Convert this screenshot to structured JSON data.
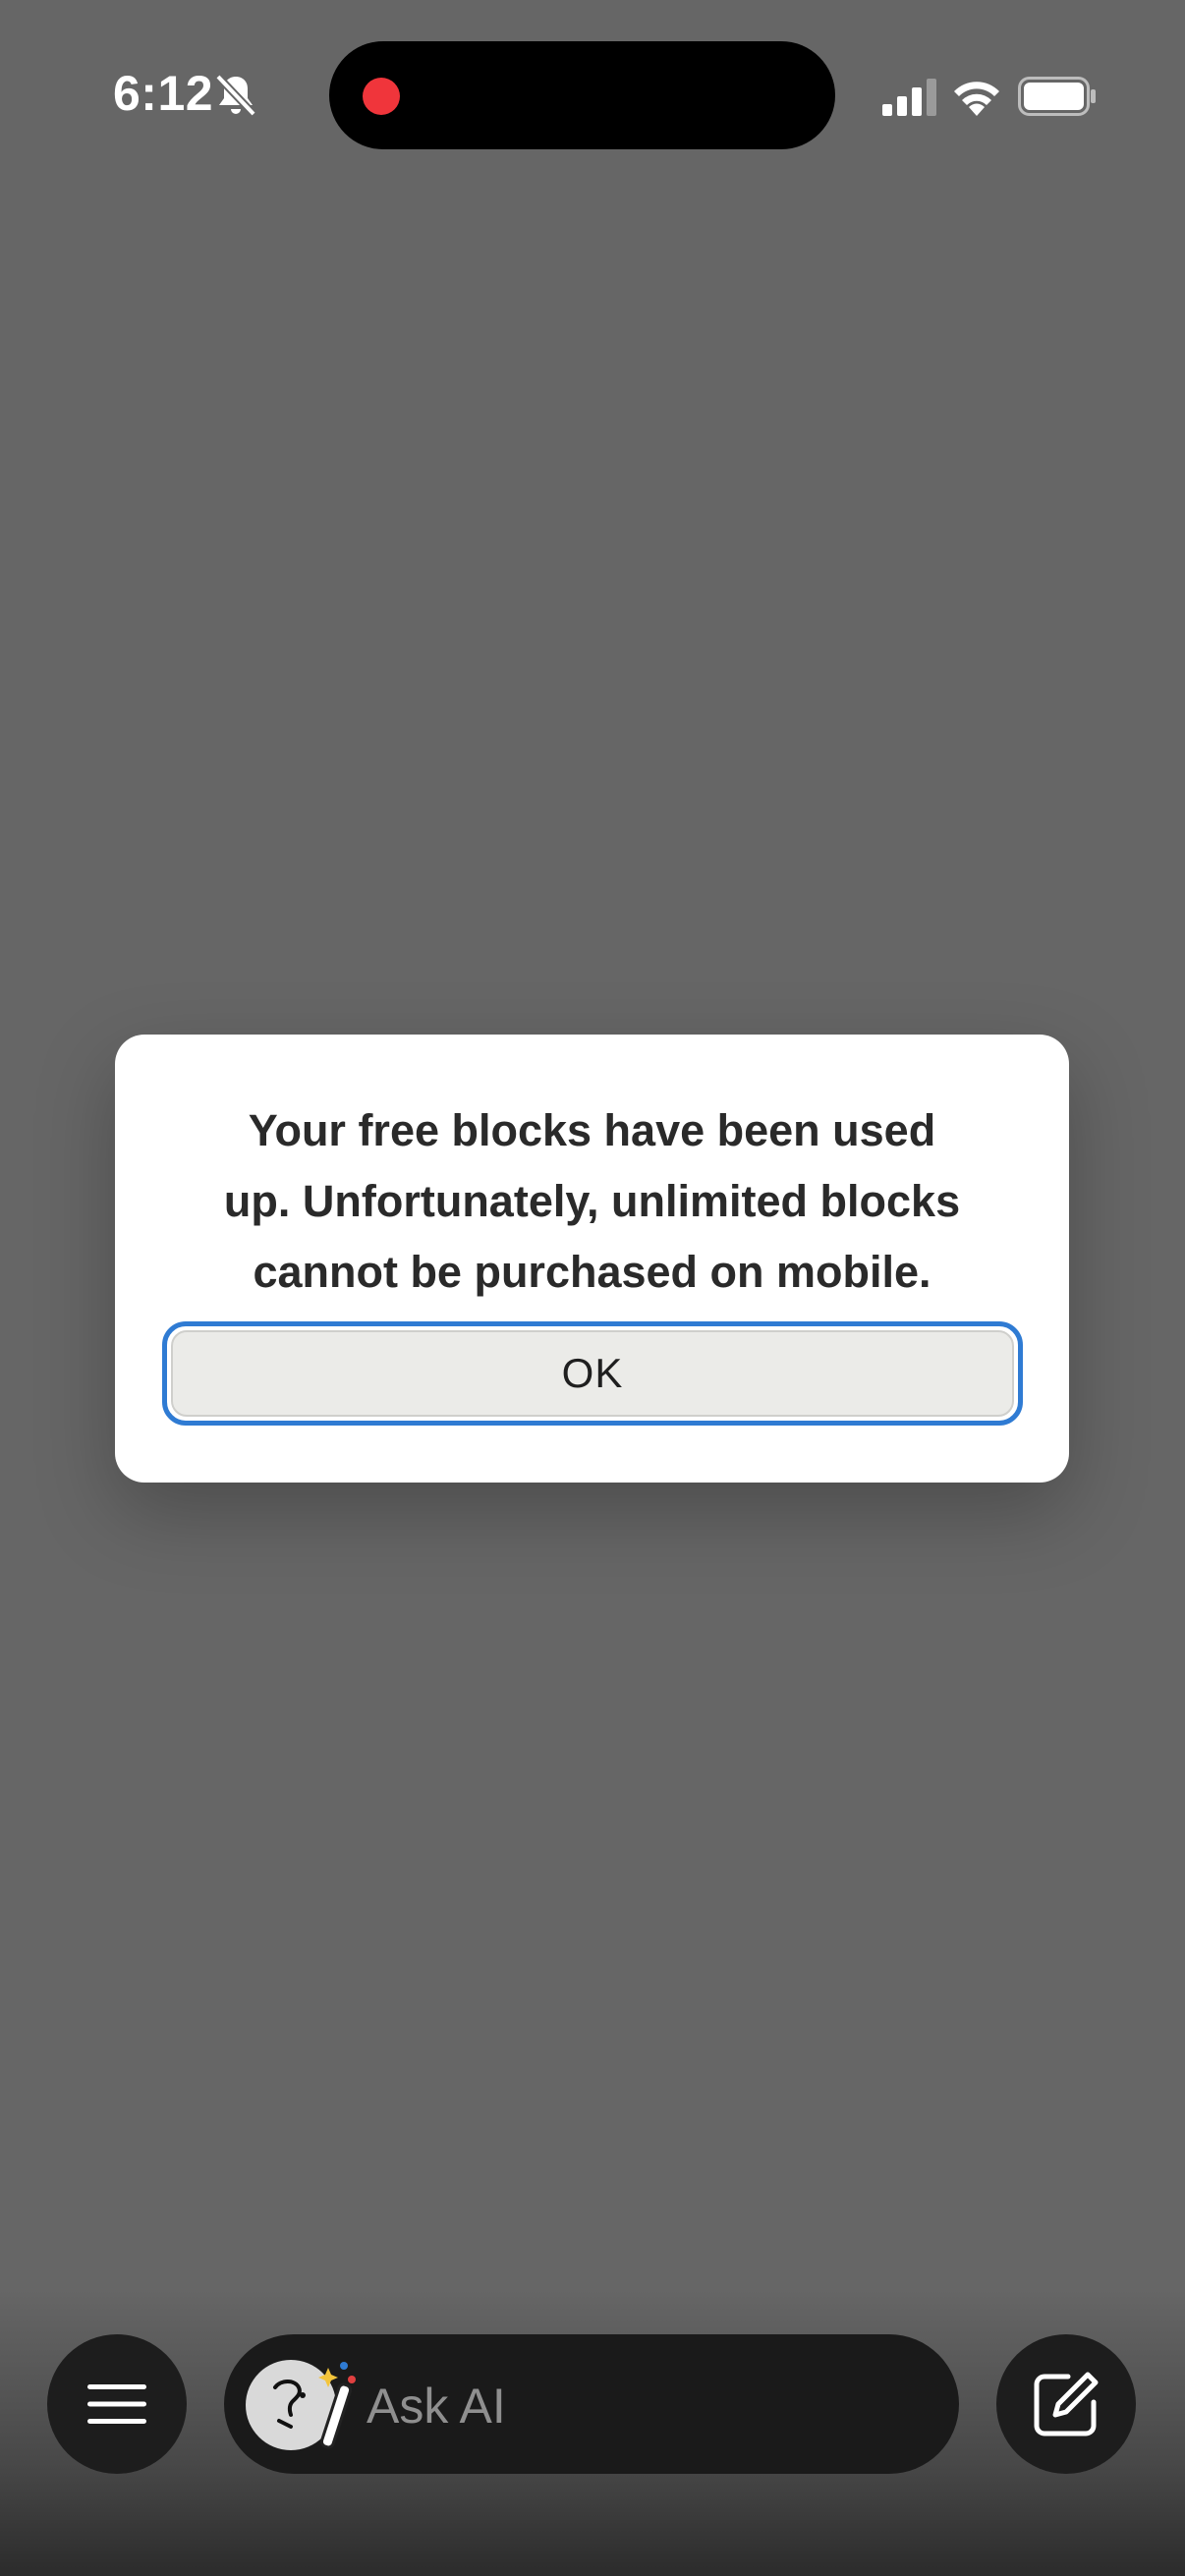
{
  "status_bar": {
    "time": "6:12",
    "icons": [
      "bell-slash-icon",
      "signal-icon",
      "wifi-icon",
      "battery-icon"
    ],
    "recording_dot_color": "#f0353b"
  },
  "dialog": {
    "message": "Your free blocks have been used\nup. Unfortunately, unlimited blocks\ncannot be purchased on mobile.",
    "ok_label": "OK",
    "focus_color": "#2f7bd3"
  },
  "bottom_bar": {
    "menu_icon": "hamburger-menu-icon",
    "ask_placeholder": "Ask AI",
    "ai_icons": [
      "ai-face-icon",
      "magic-wand-icon"
    ],
    "compose_icon": "compose-icon"
  }
}
